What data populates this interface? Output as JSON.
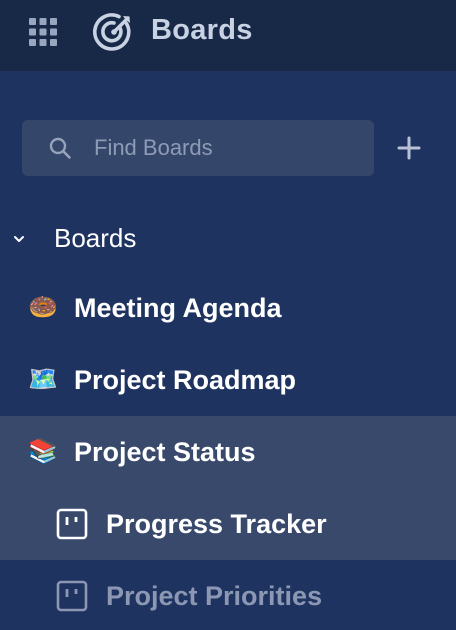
{
  "header": {
    "title": "Boards",
    "menu_icon": "grid-icon",
    "logo_icon": "target-logo-icon"
  },
  "search": {
    "placeholder": "Find Boards",
    "value": ""
  },
  "add_icon": "plus-icon",
  "tree": {
    "section_label": "Boards",
    "section_icon": "chevron-down-icon",
    "items": [
      {
        "label": "Meeting Agenda",
        "emoji": "🍩",
        "icon": "donut-emoji-icon",
        "active": false
      },
      {
        "label": "Project Roadmap",
        "emoji": "🗺️",
        "icon": "map-emoji-icon",
        "active": false
      },
      {
        "label": "Project Status",
        "emoji": "📚",
        "icon": "books-emoji-icon",
        "active": true
      }
    ],
    "sub_items": [
      {
        "label": "Progress Tracker",
        "icon": "board-icon",
        "active": true
      },
      {
        "label": "Project Priorities",
        "icon": "board-icon",
        "active": false
      }
    ]
  },
  "colors": {
    "sidebar_bg": "#1f3360",
    "header_bg": "#182948",
    "active_row_bg": "#39496b",
    "search_bg": "#34476b",
    "text_primary": "#ffffff",
    "text_muted": "#8c98b3"
  }
}
